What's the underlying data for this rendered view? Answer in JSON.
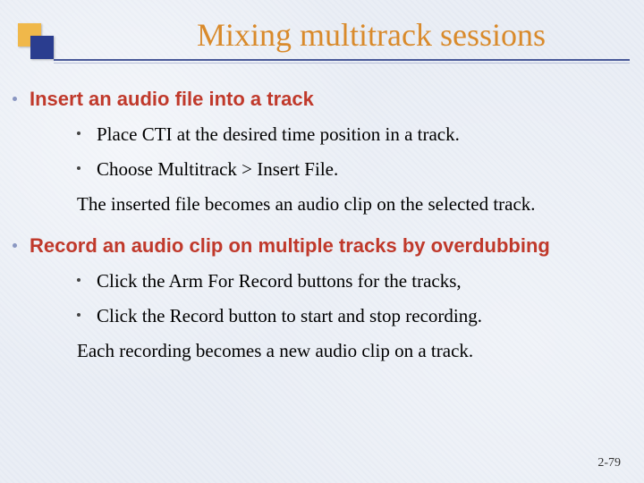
{
  "title": "Mixing multitrack sessions",
  "sections": [
    {
      "heading": "Insert an audio file into a track",
      "bullets": [
        "Place CTI at the desired time position in a track.",
        "Choose Multitrack > Insert File."
      ],
      "note": "The inserted file becomes an audio clip on the selected track."
    },
    {
      "heading": "Record an audio clip on multiple tracks by overdubbing",
      "bullets": [
        "Click the Arm For Record buttons for the tracks,",
        "Click the Record button to start and stop recording."
      ],
      "note": "Each recording becomes a new audio clip on a track."
    }
  ],
  "page_number": "2-79"
}
